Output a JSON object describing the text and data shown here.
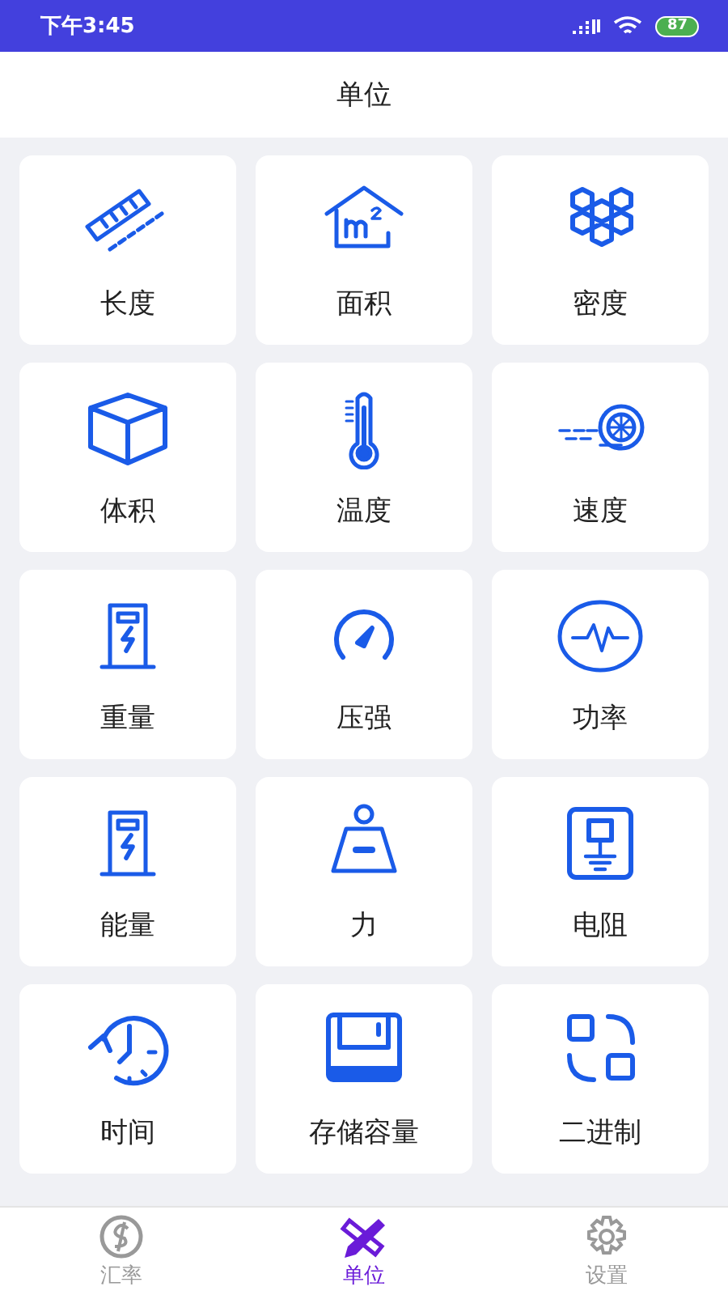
{
  "status_bar": {
    "time": "下午3:45",
    "battery": "87"
  },
  "header": {
    "title": "单位"
  },
  "units": [
    {
      "kind": "ruler",
      "label": "长度"
    },
    {
      "kind": "house",
      "label": "面积"
    },
    {
      "kind": "hex",
      "label": "密度"
    },
    {
      "kind": "cube",
      "label": "体积"
    },
    {
      "kind": "thermo",
      "label": "温度"
    },
    {
      "kind": "fan",
      "label": "速度"
    },
    {
      "kind": "meter",
      "label": "重量"
    },
    {
      "kind": "gauge",
      "label": "压强"
    },
    {
      "kind": "pulse",
      "label": "功率"
    },
    {
      "kind": "meter",
      "label": "能量"
    },
    {
      "kind": "weight",
      "label": "力"
    },
    {
      "kind": "resistor",
      "label": "电阻"
    },
    {
      "kind": "clock",
      "label": "时间"
    },
    {
      "kind": "disk",
      "label": "存储容量"
    },
    {
      "kind": "binary",
      "label": "二进制"
    }
  ],
  "tabs": [
    {
      "kind": "money",
      "label": "汇率",
      "selected": false
    },
    {
      "kind": "tools",
      "label": "单位",
      "selected": true
    },
    {
      "kind": "gear",
      "label": "设置",
      "selected": false
    }
  ]
}
